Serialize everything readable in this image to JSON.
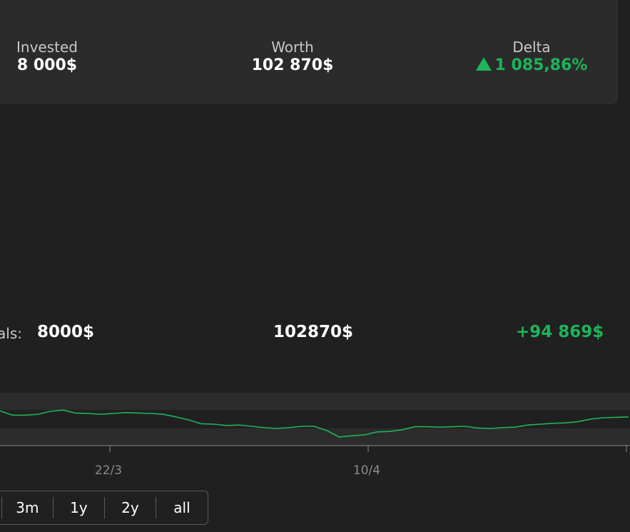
{
  "summary": {
    "invested_label": "Invested",
    "invested_value": "8 000$",
    "worth_label": "Worth",
    "worth_value": "102 870$",
    "delta_label": "Delta",
    "delta_value": "1 085,86%",
    "delta_direction": "up"
  },
  "totals": {
    "label": "als:",
    "invested": "8000$",
    "worth": "102870$",
    "delta": "+94 869$"
  },
  "chart_data": {
    "type": "line",
    "x_tick_labels": [
      "22/3",
      "10/4"
    ],
    "series": [
      {
        "color": "#1db45a",
        "values": [
          0.66,
          0.56,
          0.56,
          0.58,
          0.65,
          0.68,
          0.61,
          0.6,
          0.58,
          0.6,
          0.62,
          0.61,
          0.6,
          0.58,
          0.52,
          0.45,
          0.36,
          0.35,
          0.32,
          0.33,
          0.3,
          0.27,
          0.25,
          0.27,
          0.3,
          0.3,
          0.2,
          0.05,
          0.08,
          0.1,
          0.17,
          0.18,
          0.22,
          0.29,
          0.29,
          0.28,
          0.29,
          0.3,
          0.26,
          0.25,
          0.27,
          0.28,
          0.33,
          0.35,
          0.37,
          0.38,
          0.41,
          0.47,
          0.5,
          0.51,
          0.52
        ]
      }
    ],
    "grid": true,
    "colors": {
      "line": "#1db45a",
      "band": "#2c2c2c",
      "axis": "#8a8a8a"
    }
  },
  "range_buttons": [
    "",
    "3m",
    "1y",
    "2y",
    "all"
  ],
  "colors": {
    "background": "#202020",
    "card": "#2b2b2b",
    "positive": "#1db45a",
    "text": "#ffffff",
    "muted": "#c8c8c8"
  }
}
